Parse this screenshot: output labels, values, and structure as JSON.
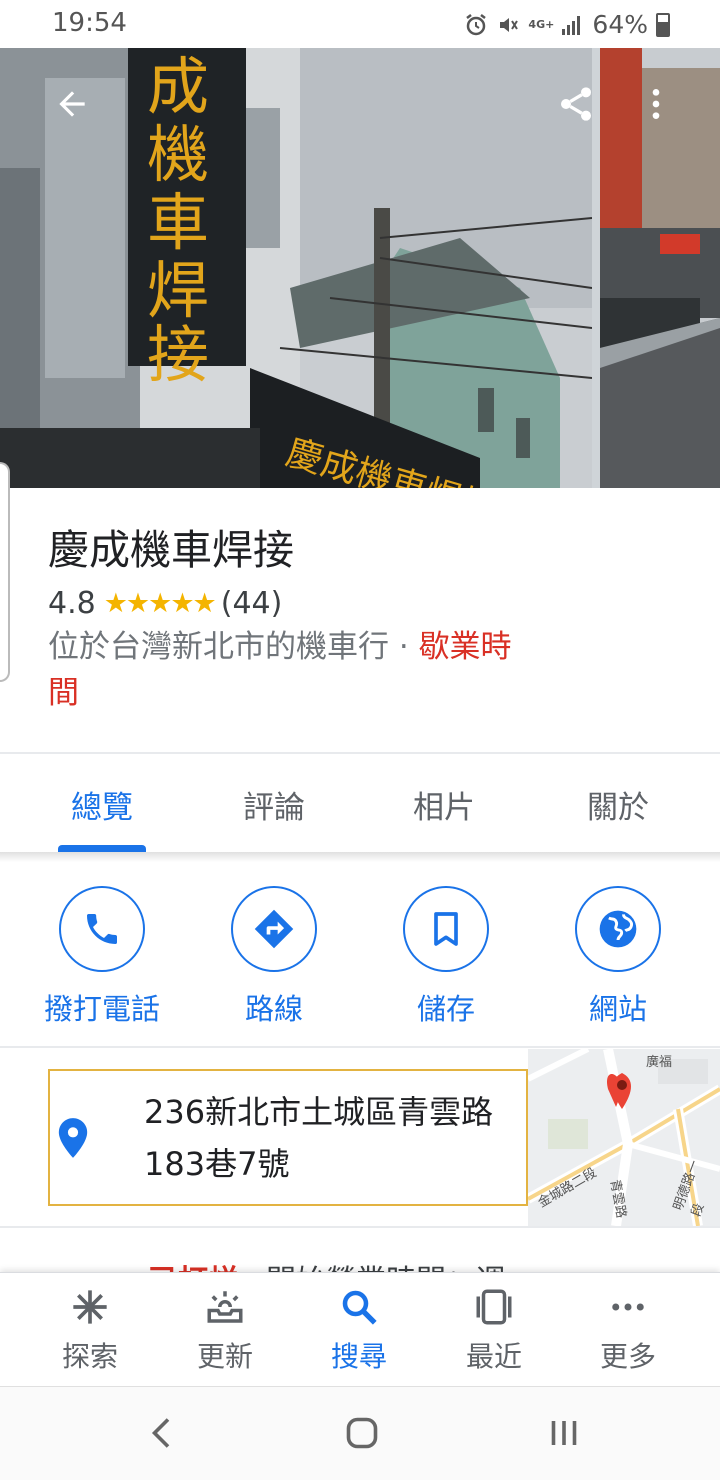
{
  "status_bar": {
    "time": "19:54",
    "network": "4G+",
    "battery": "64%",
    "icons": [
      "alarm-icon",
      "mute-icon",
      "signal-icon",
      "battery-icon"
    ]
  },
  "header": {
    "back_icon": "arrow-left-icon",
    "share_icon": "share-icon",
    "more_icon": "more-vert-icon"
  },
  "photos": {
    "sign_text": "成機車焊接",
    "shop_sign_text": "慶成機車焊接"
  },
  "place": {
    "title": "慶成機車焊接",
    "rating": "4.8",
    "stars": "★★★★★",
    "rating_value": 4.8,
    "review_count": "(44)",
    "category": "位於台灣新北市的機車行 · ",
    "hours_status": "歇業時間"
  },
  "tabs": [
    {
      "label": "總覽",
      "active": true
    },
    {
      "label": "評論",
      "active": false
    },
    {
      "label": "相片",
      "active": false
    },
    {
      "label": "關於",
      "active": false
    }
  ],
  "actions": [
    {
      "label": "撥打電話",
      "icon": "phone-icon"
    },
    {
      "label": "路線",
      "icon": "directions-icon"
    },
    {
      "label": "儲存",
      "icon": "bookmark-icon"
    },
    {
      "label": "網站",
      "icon": "globe-icon"
    }
  ],
  "address": {
    "text": "236新北市土城區青雲路183巷7號",
    "icon": "location-pin-icon",
    "map_labels": [
      "金城路二段",
      "青雲路",
      "明德路一段",
      "廣福"
    ]
  },
  "peek": {
    "status": "已打烊",
    "hours_text": "開始營業時間：週"
  },
  "bottom_nav": [
    {
      "label": "探索",
      "icon": "explore-icon",
      "active": false
    },
    {
      "label": "更新",
      "icon": "updates-icon",
      "active": false
    },
    {
      "label": "搜尋",
      "icon": "search-icon",
      "active": true
    },
    {
      "label": "最近",
      "icon": "recents-icon",
      "active": false
    },
    {
      "label": "更多",
      "icon": "more-horiz-icon",
      "active": false
    }
  ],
  "system_nav": [
    "back-icon",
    "home-icon",
    "recent-apps-icon"
  ],
  "colors": {
    "accent": "#1a73e8",
    "star": "#f4b400",
    "closed_red": "#d93025",
    "address_border": "#e3b341",
    "map_pin": "#ea4335"
  }
}
